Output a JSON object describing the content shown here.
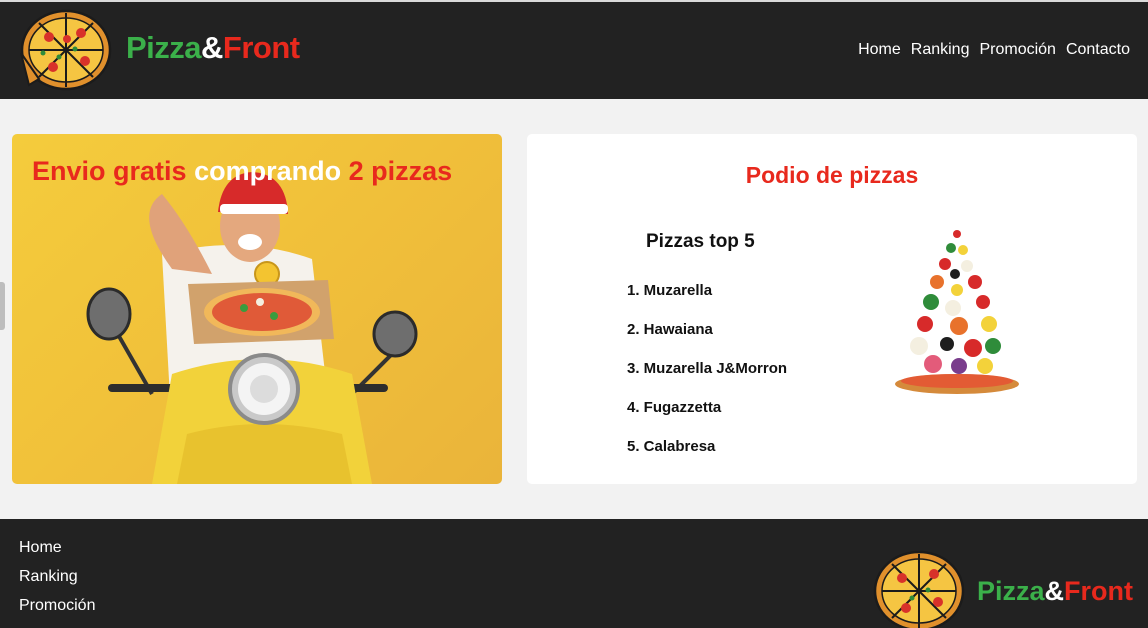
{
  "brand": {
    "part1": "Pizza",
    "part2": "&",
    "part3": "Front"
  },
  "nav": [
    {
      "label": "Home"
    },
    {
      "label": "Ranking"
    },
    {
      "label": "Promoción"
    },
    {
      "label": "Contacto"
    }
  ],
  "promo": {
    "title_part1": "Envio gratis",
    "title_part2": "comprando",
    "title_part3": "2 pizzas",
    "image_icon": "delivery-scooter-photo"
  },
  "podio": {
    "title": "Podio de pizzas",
    "list_title": "Pizzas top 5",
    "items": [
      {
        "label": "1. Muzarella"
      },
      {
        "label": "2. Hawaiana"
      },
      {
        "label": "3. Muzarella J&Morron"
      },
      {
        "label": "4. Fugazzetta"
      },
      {
        "label": "5. Calabresa"
      }
    ],
    "image_icon": "flying-pizza-ingredients"
  },
  "footer": {
    "links": [
      {
        "label": "Home"
      },
      {
        "label": "Ranking"
      },
      {
        "label": "Promoción"
      }
    ],
    "brand": {
      "part1": "Pizza",
      "part2": "&",
      "part3": "Front"
    }
  },
  "colors": {
    "dark": "#222222",
    "brand_green": "#3bb04a",
    "brand_red": "#e8291d",
    "promo_yellow": "#f1c13a",
    "background": "#f2f2f2"
  }
}
